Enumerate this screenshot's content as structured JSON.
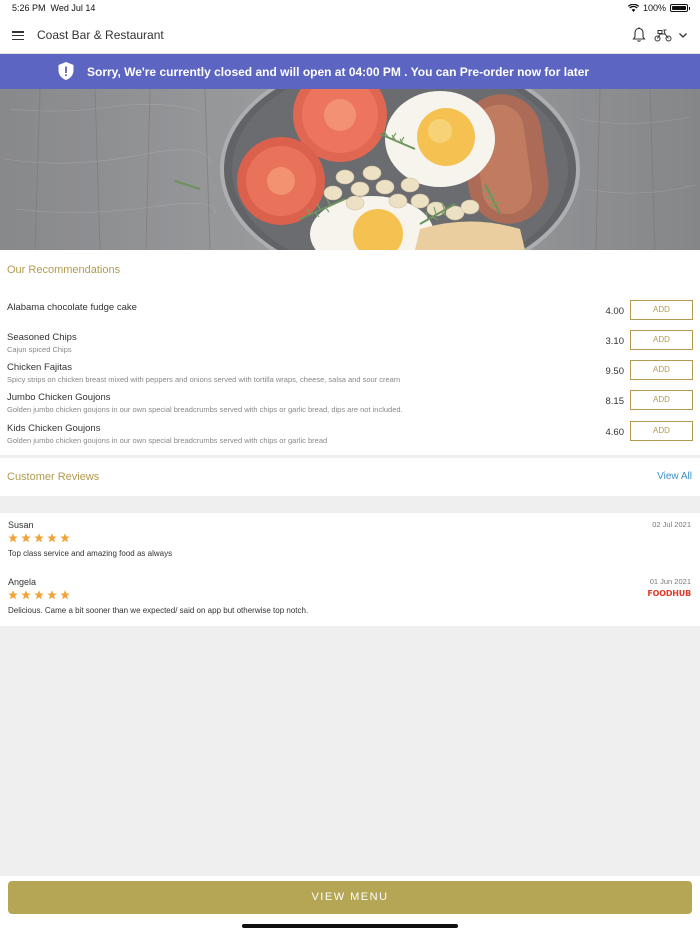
{
  "status_bar": {
    "time": "5:26 PM",
    "date": "Wed Jul 14",
    "battery": "100%"
  },
  "header": {
    "title": "Coast Bar & Restaurant"
  },
  "banner": {
    "message": "Sorry, We're currently closed and will open at 04:00 PM . You can Pre-order now for later"
  },
  "recommendations": {
    "title": "Our Recommendations",
    "add_label": "ADD",
    "items": [
      {
        "name": "Alabama chocolate fudge cake",
        "description": "",
        "price": "4.00"
      },
      {
        "name": "Seasoned Chips",
        "description": "Cajun spiced Chips",
        "price": "3.10"
      },
      {
        "name": "Chicken Fajitas",
        "description": "Spicy strips on chicken breast mixed with peppers and onions served with tortilla wraps, cheese, salsa and sour cream",
        "price": "9.50"
      },
      {
        "name": "Jumbo Chicken Goujons",
        "description": "Golden jumbo chicken goujons in our own special breadcrumbs served with chips or garlic bread, dips are not included.",
        "price": "8.15"
      },
      {
        "name": "Kids Chicken Goujons",
        "description": "Golden jumbo chicken goujons in our own special breadcrumbs served with chips or garlic bread",
        "price": "4.60"
      }
    ]
  },
  "reviews": {
    "title": "Customer Reviews",
    "view_all": "View All",
    "items": [
      {
        "author": "Susan",
        "date": "02 Jul 2021",
        "rating": 5,
        "text": "Top class service and amazing food as always",
        "source": ""
      },
      {
        "author": "Angela",
        "date": "01 Jun 2021",
        "rating": 5,
        "text": "Delicious. Came a bit sooner than we expected/ said on app but otherwise top notch.",
        "source": "FOODHUB"
      }
    ]
  },
  "footer": {
    "view_menu": "VIEW MENU"
  },
  "colors": {
    "banner": "#5c65c1",
    "accent": "#b49a4f",
    "button": "#b5a656",
    "star": "#f2a33a",
    "link": "#3a8fc7",
    "foodhub": "#e03a2a"
  },
  "icons": [
    "menu-icon",
    "bell-icon",
    "scooter-icon",
    "chevron-down-icon",
    "shield-icon",
    "wifi-icon",
    "battery-icon",
    "star-icon"
  ]
}
